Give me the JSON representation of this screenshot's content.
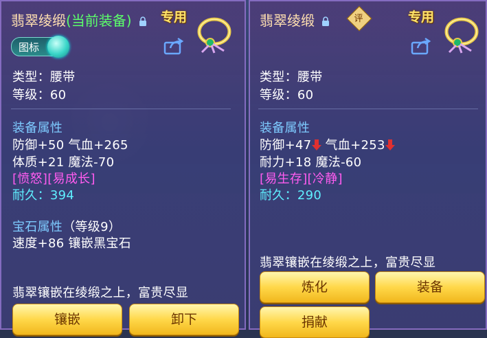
{
  "left": {
    "title_name": "翡翠绫缎",
    "title_current": "(当前装备)",
    "special_label": "专用",
    "toggle_label": "图标",
    "type_line": "类型：腰带",
    "level_line": "等级：60",
    "attr_header": "装备属性",
    "attr_line1": "防御+50 气血+265",
    "attr_line2": "体质+21 魔法-70",
    "traits": "[愤怒][易成长]",
    "durability_label": "耐久：",
    "durability_value": "394",
    "gem_header": "宝石属性",
    "gem_level": "（等级9）",
    "gem_line": "速度+86 镶嵌黑宝石",
    "description": "翡翠镶嵌在绫缎之上，富贵尽显",
    "buttons": [
      "镶嵌",
      "卸下"
    ]
  },
  "right": {
    "title_name": "翡翠绫缎",
    "rate_badge": "评",
    "special_label": "专用",
    "type_line": "类型：腰带",
    "level_line": "等级：60",
    "attr_header": "装备属性",
    "attr_def": "防御+47",
    "attr_hp": " 气血+253",
    "attr_line2": "耐力+18 魔法-60",
    "traits": "[易生存][冷静]",
    "durability_label": "耐久：",
    "durability_value": "290",
    "description": "翡翠镶嵌在绫缎之上，富贵尽显",
    "buttons": [
      "炼化",
      "装备",
      "捐献"
    ]
  },
  "colors": {
    "title": "#ffe0b0",
    "current": "#5cff6a",
    "header": "#7ecbff",
    "trait": "#ff5cf0",
    "durability": "#5ff0ff",
    "button": "#ffd84a"
  },
  "icons": [
    "lock-icon",
    "item-belt-icon",
    "share-icon",
    "down-arrow-icon"
  ]
}
